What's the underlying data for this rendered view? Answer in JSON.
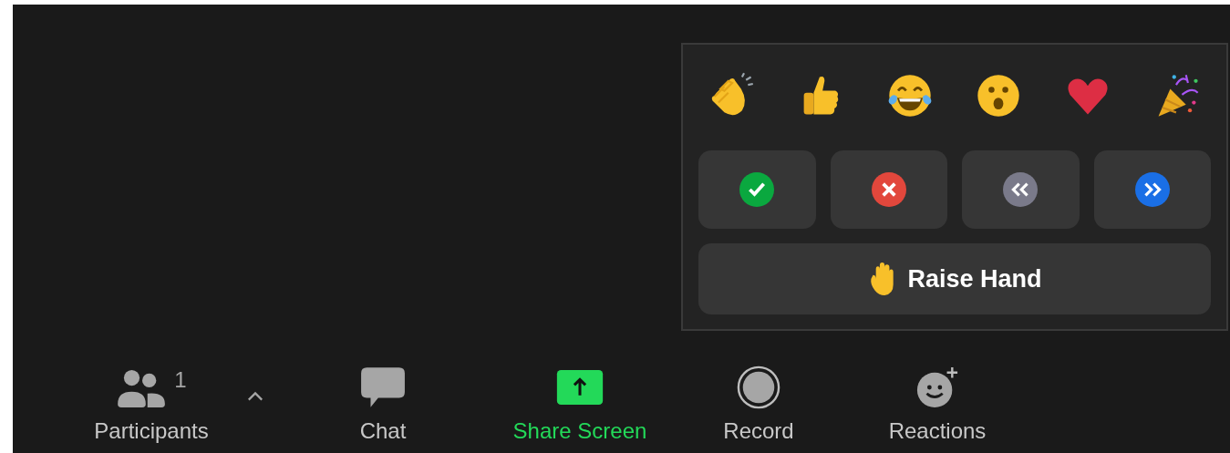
{
  "reactions_popup": {
    "emoji": [
      {
        "kind": "clap"
      },
      {
        "kind": "thumbs_up"
      },
      {
        "kind": "laugh"
      },
      {
        "kind": "wow"
      },
      {
        "kind": "heart"
      },
      {
        "kind": "party"
      }
    ],
    "feedback": [
      {
        "kind": "yes",
        "color": "#0aa83f"
      },
      {
        "kind": "no",
        "color": "#e2473c"
      },
      {
        "kind": "slower",
        "color": "#7a7a8a"
      },
      {
        "kind": "faster",
        "color": "#1a6fe6"
      }
    ],
    "raise_hand": {
      "label": "Raise Hand"
    }
  },
  "toolbar": [
    {
      "kind": "participants",
      "label": "Participants",
      "count": "1"
    },
    {
      "kind": "chat",
      "label": "Chat"
    },
    {
      "kind": "share",
      "label": "Share Screen"
    },
    {
      "kind": "record",
      "label": "Record"
    },
    {
      "kind": "reactions",
      "label": "Reactions"
    }
  ]
}
